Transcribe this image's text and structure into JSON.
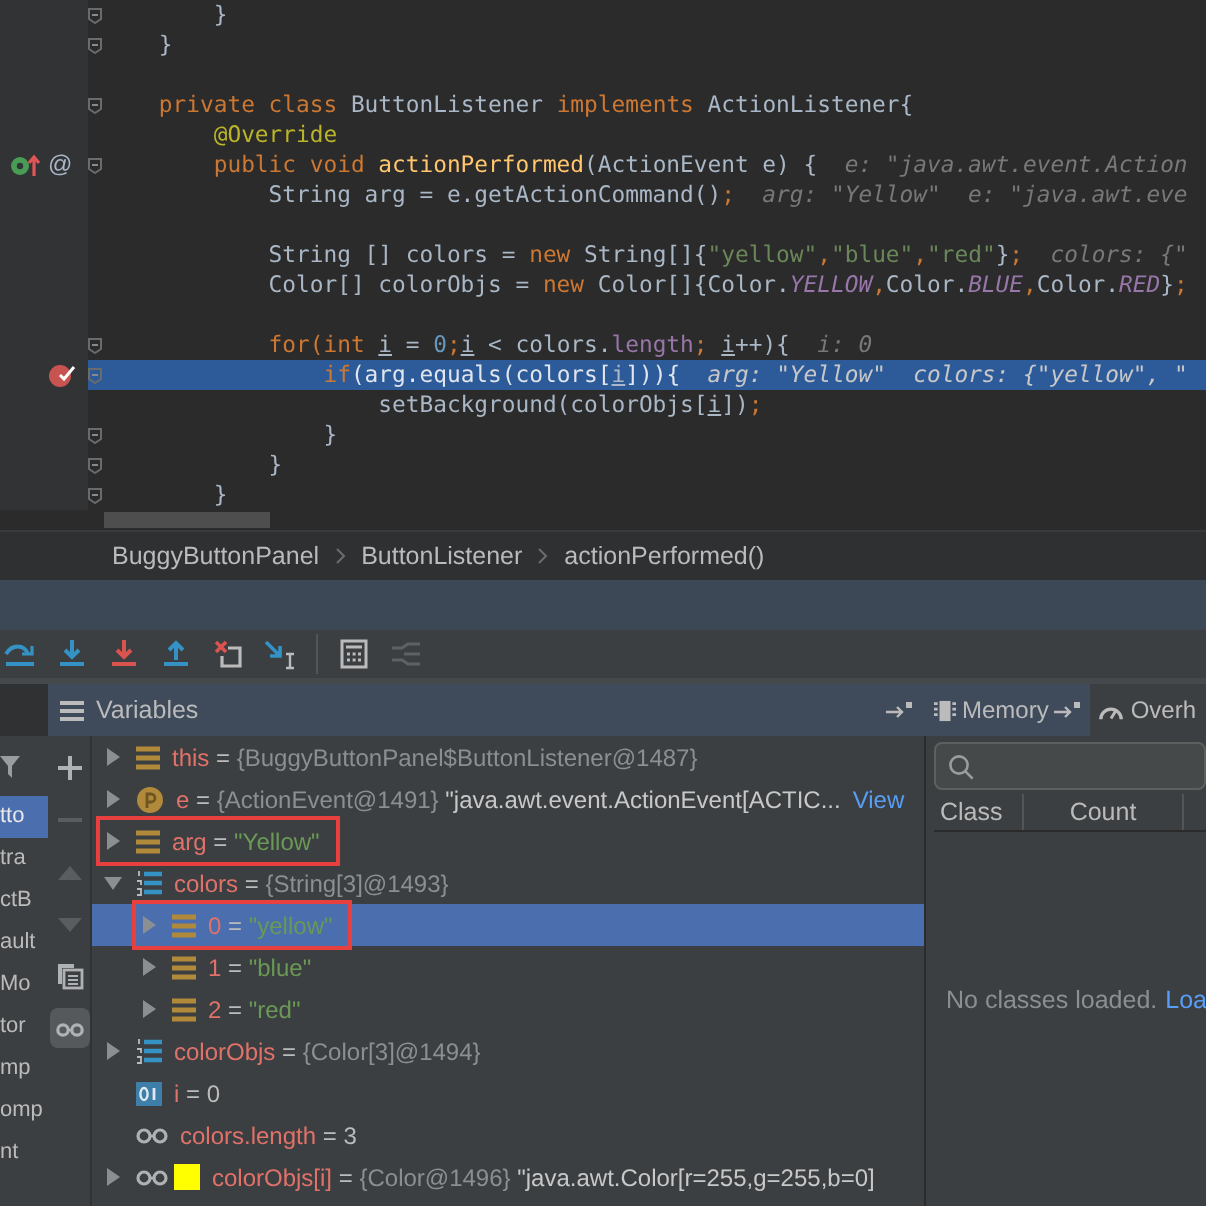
{
  "editor": {
    "lines": [
      {
        "current": false,
        "fold": true,
        "tokens": [
          {
            "kind": "plain",
            "text": "        }"
          }
        ]
      },
      {
        "current": false,
        "fold": true,
        "tokens": [
          {
            "kind": "plain",
            "text": "    }"
          }
        ]
      },
      {
        "current": false,
        "fold": false
      },
      {
        "current": false,
        "fold": true,
        "tokens": [
          {
            "kind": "kw",
            "text": "    private class "
          },
          {
            "kind": "plain",
            "text": "ButtonListener "
          },
          {
            "kind": "kw",
            "text": "implements "
          },
          {
            "kind": "plain",
            "text": "ActionListener{"
          }
        ]
      },
      {
        "current": false,
        "fold": false,
        "tokens": [
          {
            "kind": "ann",
            "text": "        @Override"
          }
        ]
      },
      {
        "current": false,
        "fold": true,
        "gutter_icon": {
          "kind": "override"
        },
        "gutter_mark": "@",
        "tokens": [
          {
            "kind": "kw",
            "text": "        public void "
          },
          {
            "kind": "method",
            "text": "actionPerformed"
          },
          {
            "kind": "plain",
            "text": "(ActionEvent e) {"
          },
          {
            "kind": "hint",
            "text": "  e: \"java.awt.event.Action"
          }
        ]
      },
      {
        "current": false,
        "fold": false,
        "tokens": [
          {
            "kind": "plain",
            "text": "            String arg = e.getActionCommand()"
          },
          {
            "kind": "kw",
            "text": ";"
          },
          {
            "kind": "hint",
            "text": "  arg: \"Yellow\"  e: \"java.awt.eve"
          }
        ]
      },
      {
        "current": false,
        "fold": false
      },
      {
        "current": false,
        "fold": false,
        "tokens": [
          {
            "kind": "plain",
            "text": "            String [] colors = "
          },
          {
            "kind": "kw",
            "text": "new "
          },
          {
            "kind": "plain",
            "text": "String[]{"
          },
          {
            "kind": "str",
            "text": "\"yellow\""
          },
          {
            "kind": "kw",
            "text": ","
          },
          {
            "kind": "str",
            "text": "\"blue\""
          },
          {
            "kind": "kw",
            "text": ","
          },
          {
            "kind": "str",
            "text": "\"red\""
          },
          {
            "kind": "plain",
            "text": "}"
          },
          {
            "kind": "kw",
            "text": ";"
          },
          {
            "kind": "hint",
            "text": "  colors: {\""
          }
        ]
      },
      {
        "current": false,
        "fold": false,
        "tokens": [
          {
            "kind": "plain",
            "text": "            Color[] colorObjs = "
          },
          {
            "kind": "kw",
            "text": "new "
          },
          {
            "kind": "plain",
            "text": "Color[]{Color."
          },
          {
            "kind": "const",
            "text": "YELLOW"
          },
          {
            "kind": "kw",
            "text": ","
          },
          {
            "kind": "plain",
            "text": "Color."
          },
          {
            "kind": "const",
            "text": "BLUE"
          },
          {
            "kind": "kw",
            "text": ","
          },
          {
            "kind": "plain",
            "text": "Color."
          },
          {
            "kind": "const",
            "text": "RED"
          },
          {
            "kind": "plain",
            "text": "}"
          },
          {
            "kind": "kw",
            "text": ";"
          }
        ]
      },
      {
        "current": false,
        "fold": false
      },
      {
        "current": false,
        "fold": true,
        "tokens": [
          {
            "kind": "kw",
            "text": "            for(int "
          },
          {
            "kind": "ivar",
            "text": "i"
          },
          {
            "kind": "plain",
            "text": " = "
          },
          {
            "kind": "num",
            "text": "0"
          },
          {
            "kind": "kw",
            "text": ";"
          },
          {
            "kind": "ivar",
            "text": "i"
          },
          {
            "kind": "plain",
            "text": " < colors."
          },
          {
            "kind": "field",
            "text": "length"
          },
          {
            "kind": "kw",
            "text": "; "
          },
          {
            "kind": "ivar",
            "text": "i"
          },
          {
            "kind": "plain",
            "text": "++){"
          },
          {
            "kind": "hint",
            "text": "  i: 0"
          }
        ]
      },
      {
        "current": true,
        "fold": true,
        "gutter_icon": {
          "kind": "breakpoint"
        },
        "tokens": [
          {
            "kind": "kw",
            "text": "                if"
          },
          {
            "kind": "plain",
            "text": "(arg.equals(colors["
          },
          {
            "kind": "ivar",
            "text": "i"
          },
          {
            "kind": "plain",
            "text": "])){"
          },
          {
            "kind": "hint",
            "text": "  arg: \"Yellow\"  colors: {\"yellow\", \""
          }
        ]
      },
      {
        "current": false,
        "fold": false,
        "tokens": [
          {
            "kind": "plain",
            "text": "                    setBackground(colorObjs["
          },
          {
            "kind": "ivar",
            "text": "i"
          },
          {
            "kind": "plain",
            "text": "])"
          },
          {
            "kind": "kw",
            "text": ";"
          }
        ]
      },
      {
        "current": false,
        "fold": true,
        "tokens": [
          {
            "kind": "plain",
            "text": "                }"
          }
        ]
      },
      {
        "current": false,
        "fold": true,
        "tokens": [
          {
            "kind": "plain",
            "text": "            }"
          }
        ]
      },
      {
        "current": false,
        "fold": true,
        "tokens": [
          {
            "kind": "plain",
            "text": "        }"
          }
        ]
      }
    ]
  },
  "breadcrumbs": [
    "BuggyButtonPanel",
    "ButtonListener",
    "actionPerformed()"
  ],
  "toolbar": [
    {
      "kind": "step-over",
      "disabled": false
    },
    {
      "kind": "step-into",
      "disabled": false
    },
    {
      "kind": "force-step-into",
      "disabled": false
    },
    {
      "kind": "step-out",
      "disabled": false
    },
    {
      "kind": "drop-frame",
      "disabled": false
    },
    {
      "kind": "run-to-cursor",
      "disabled": false
    },
    {
      "kind": "separator"
    },
    {
      "kind": "evaluate",
      "disabled": false
    },
    {
      "kind": "trace",
      "disabled": true
    }
  ],
  "frames": [
    {
      "text": "tto",
      "selected": true
    },
    {
      "text": "tra",
      "selected": false
    },
    {
      "text": "ctB",
      "selected": false
    },
    {
      "text": "ault",
      "selected": false
    },
    {
      "text": "Mo",
      "selected": false
    },
    {
      "text": "tor",
      "selected": false
    },
    {
      "text": "mp",
      "selected": false
    },
    {
      "text": "omp",
      "selected": false
    },
    {
      "text": "nt",
      "selected": false
    }
  ],
  "side_tools": [
    {
      "kind": "add",
      "selected": false,
      "disabled": false
    },
    {
      "kind": "remove",
      "selected": false,
      "disabled": true
    },
    {
      "kind": "up",
      "selected": false,
      "disabled": true
    },
    {
      "kind": "down",
      "selected": false,
      "disabled": true
    },
    {
      "kind": "copy",
      "selected": false,
      "disabled": false
    },
    {
      "kind": "watches",
      "selected": true,
      "disabled": false
    }
  ],
  "variables": {
    "title": "Variables",
    "rows": [
      {
        "kind": "field",
        "expanded": false,
        "name": "this",
        "sep": "=",
        "value": "{BuggyButtonPanel$ButtonListener@1487}",
        "selected": false,
        "marked": false
      },
      {
        "kind": "param",
        "expanded": false,
        "name": "e",
        "sep": "=",
        "value": "{ActionEvent@1491}",
        "detail": "\"java.awt.event.ActionEvent[ACTIC...",
        "link": "View",
        "selected": false,
        "marked": false
      },
      {
        "kind": "field",
        "expanded": false,
        "name": "arg",
        "sep": "=",
        "string": "\"Yellow\"",
        "selected": false,
        "marked": true
      },
      {
        "kind": "array",
        "expanded": true,
        "name": "colors",
        "sep": "=",
        "value": "{String[3]@1493}",
        "selected": false,
        "marked": false,
        "children": [
          {
            "kind": "field",
            "expanded": false,
            "name": "0",
            "sep": "=",
            "string": "\"yellow\"",
            "selected": true,
            "marked": true
          },
          {
            "kind": "field",
            "expanded": false,
            "name": "1",
            "sep": "=",
            "string": "\"blue\"",
            "selected": false,
            "marked": false
          },
          {
            "kind": "field",
            "expanded": false,
            "name": "2",
            "sep": "=",
            "string": "\"red\"",
            "selected": false,
            "marked": false
          }
        ]
      },
      {
        "kind": "array",
        "expanded": false,
        "name": "colorObjs",
        "sep": "=",
        "value": "{Color[3]@1494}",
        "selected": false,
        "marked": false
      },
      {
        "kind": "primitive",
        "name": "i",
        "sep": "=",
        "number": "0",
        "selected": false,
        "marked": false
      },
      {
        "kind": "watch",
        "name": "colors.length",
        "sep": "=",
        "number": "3",
        "selected": false,
        "marked": false
      },
      {
        "kind": "watch",
        "expanded": false,
        "color": "#ffff00",
        "name": "colorObjs[i]",
        "sep": "=",
        "value": "{Color@1496}",
        "detail": "\"java.awt.Color[r=255,g=255,b=0]",
        "selected": false,
        "marked": false
      }
    ]
  },
  "memory": {
    "tabs": [
      {
        "label": "Memory",
        "selected": true
      },
      {
        "label": "Overh",
        "selected": false
      }
    ],
    "columns": [
      "Class",
      "Count"
    ],
    "empty_text": "No classes loaded.",
    "empty_link": "Loa"
  }
}
